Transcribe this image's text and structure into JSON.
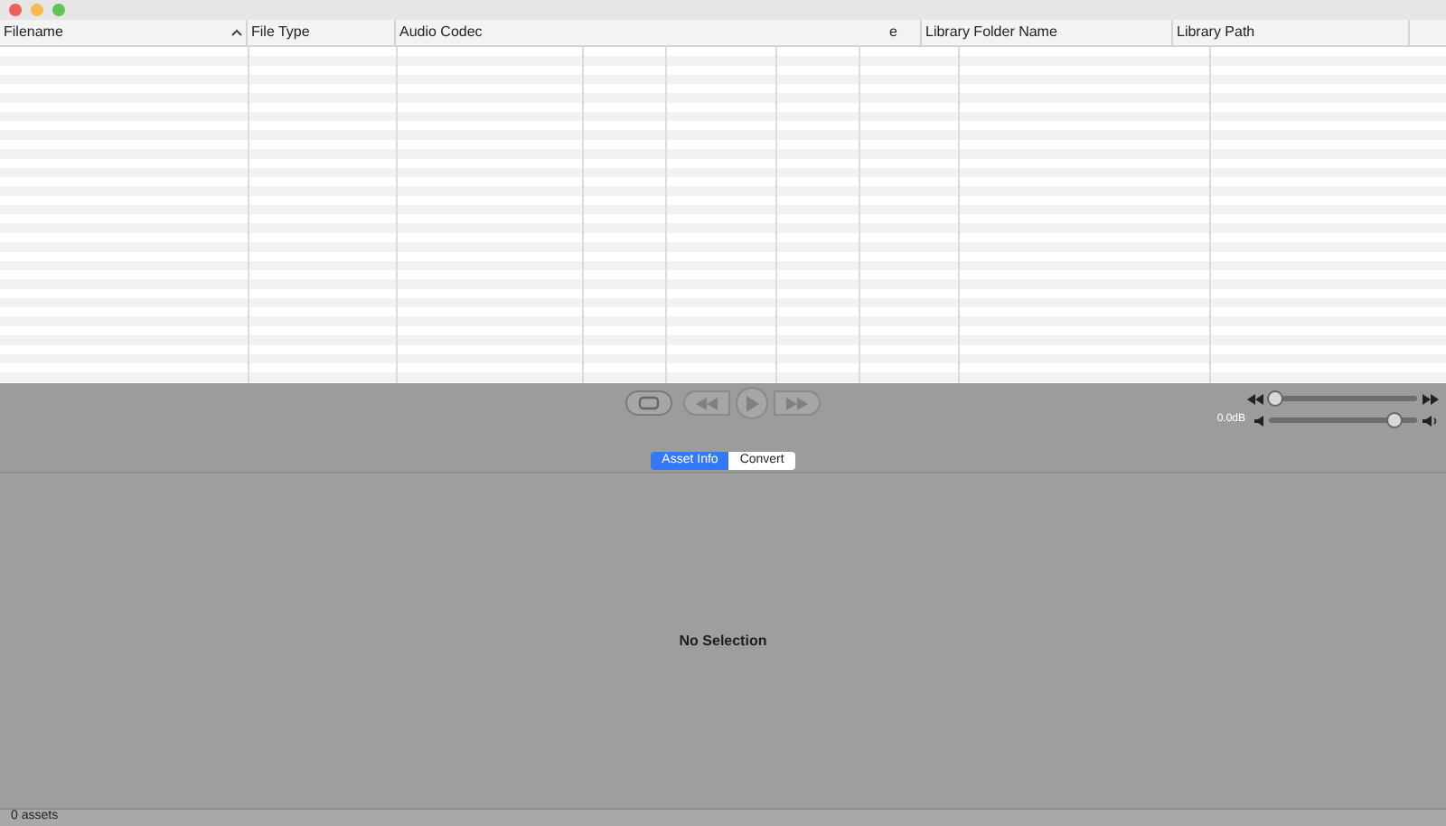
{
  "table": {
    "columns": [
      {
        "label": "Filename",
        "sorted": true
      },
      {
        "label": "File Type",
        "sorted": false
      },
      {
        "label": "Audio Codec",
        "sorted": false
      },
      {
        "label": "e",
        "sorted": false
      },
      {
        "label": "Library Folder Name",
        "sorted": false
      },
      {
        "label": "Library Path",
        "sorted": false
      }
    ]
  },
  "player": {
    "position": {
      "level": 0.04
    },
    "volume": {
      "level": 0.84,
      "reading": "0.0dB"
    }
  },
  "tabs": [
    {
      "label": "Asset Info",
      "selected": true
    },
    {
      "label": "Convert",
      "selected": false
    }
  ],
  "detail": {
    "message": "No Selection"
  },
  "status_bar": {
    "text": "0 assets"
  }
}
